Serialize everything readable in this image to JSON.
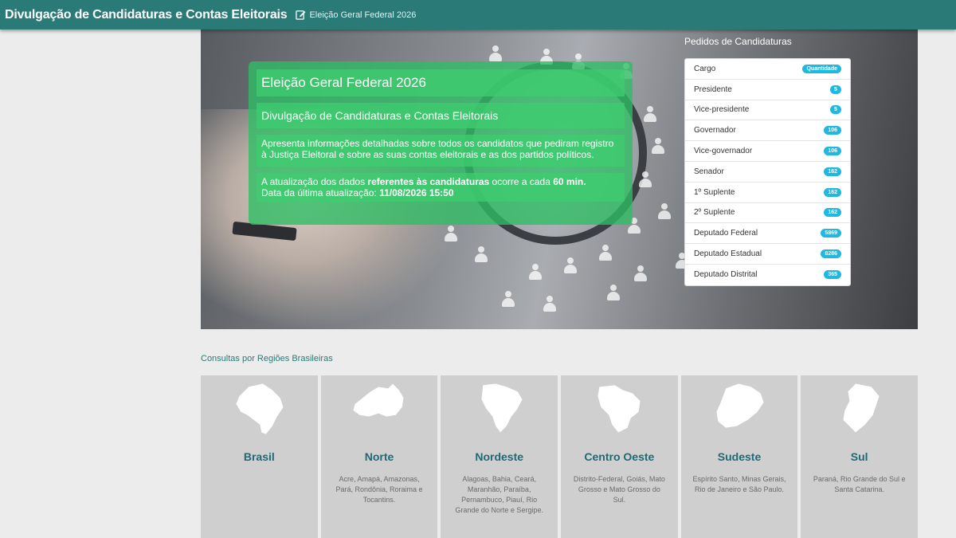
{
  "header": {
    "title": "Divulgação de Candidaturas e Contas Eleitorais",
    "election_link": "Eleição Geral Federal 2026"
  },
  "hero": {
    "title": "Eleição Geral Federal 2026",
    "subtitle": "Divulgação de Candidaturas e Contas Eleitorais",
    "description": "Apresenta informações detalhadas sobre todos os candidatos que pediram registro à Justiça Eleitoral e sobre as suas contas eleitorais e as dos partidos políticos.",
    "update_prefix": "A atualização dos dados ",
    "update_bold": "referentes às candidaturas",
    "update_middle": " ocorre a cada ",
    "update_interval": "60 min.",
    "last_update_label": "Data da última atualização: ",
    "last_update_value": "11/08/2026 15:50"
  },
  "candidaturas": {
    "title": "Pedidos de Candidaturas",
    "header_label": "Cargo",
    "header_badge": "Quantidade",
    "rows": [
      {
        "cargo": "Presidente",
        "qtd": "5"
      },
      {
        "cargo": "Vice-presidente",
        "qtd": "5"
      },
      {
        "cargo": "Governador",
        "qtd": "106"
      },
      {
        "cargo": "Vice-governador",
        "qtd": "106"
      },
      {
        "cargo": "Senador",
        "qtd": "162"
      },
      {
        "cargo": "1º Suplente",
        "qtd": "162"
      },
      {
        "cargo": "2º Suplente",
        "qtd": "162"
      },
      {
        "cargo": "Deputado Federal",
        "qtd": "5869"
      },
      {
        "cargo": "Deputado Estadual",
        "qtd": "8286"
      },
      {
        "cargo": "Deputado Distrital",
        "qtd": "365"
      }
    ]
  },
  "regions": {
    "heading": "Consultas por Regiões Brasileiras",
    "items": [
      {
        "name": "Brasil",
        "states": "",
        "icon": "brazil-map-icon"
      },
      {
        "name": "Norte",
        "states": "Acre, Amapá, Amazonas, Pará, Rondônia, Roraima e Tocantins.",
        "icon": "north-region-map-icon"
      },
      {
        "name": "Nordeste",
        "states": "Alagoas, Bahia, Ceará, Maranhão, Paraíba, Pernambuco, Piauí, Rio Grande do Norte e Sergipe.",
        "icon": "northeast-region-map-icon"
      },
      {
        "name": "Centro Oeste",
        "states": "Distrito-Federal, Goiás, Mato Grosso e Mato Grosso do Sul.",
        "icon": "center-west-region-map-icon"
      },
      {
        "name": "Sudeste",
        "states": "Espírito Santo, Minas Gerais, Rio de Janeiro e São Paulo.",
        "icon": "southeast-region-map-icon"
      },
      {
        "name": "Sul",
        "states": "Paraná, Rio Grande do Sul e Santa Catarina.",
        "icon": "south-region-map-icon"
      }
    ]
  },
  "colors": {
    "topbar": "#2a7a78",
    "card_green": "#2ebe64",
    "badge": "#1fb8e0",
    "region_title": "#1e6a74"
  }
}
